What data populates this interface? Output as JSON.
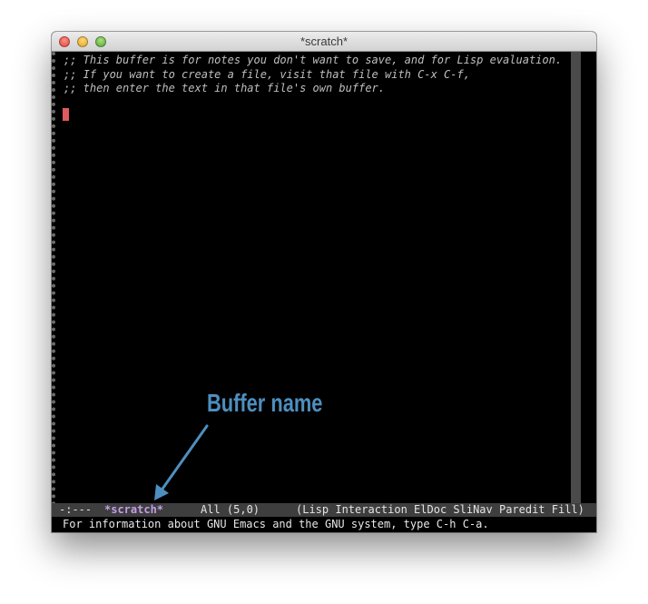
{
  "window": {
    "title": "*scratch*",
    "controls": [
      "close-button",
      "minimize-button",
      "zoom-button"
    ]
  },
  "editor": {
    "lines": [
      ";; This buffer is for notes you don't want to save, and for Lisp evaluation.",
      ";; If you want to create a file, visit that file with C-x C-f,",
      ";; then enter the text in that file's own buffer."
    ]
  },
  "modeline": {
    "status": "-:---",
    "buffer_name": "*scratch*",
    "position": "All (5,0)",
    "modes": "(Lisp Interaction ElDoc SliNav Paredit Fill)"
  },
  "echo_area": {
    "message": "For information about GNU Emacs and the GNU system, type C-h C-a."
  },
  "annotation": {
    "label": "Buffer name"
  },
  "colors": {
    "background": "#000000",
    "text": "#bfbfbf",
    "cursor": "#e05a5f",
    "buffer_name": "#c49ee6",
    "modeline_bg": "#3e3e3e",
    "annotation": "#4d8fbf"
  }
}
